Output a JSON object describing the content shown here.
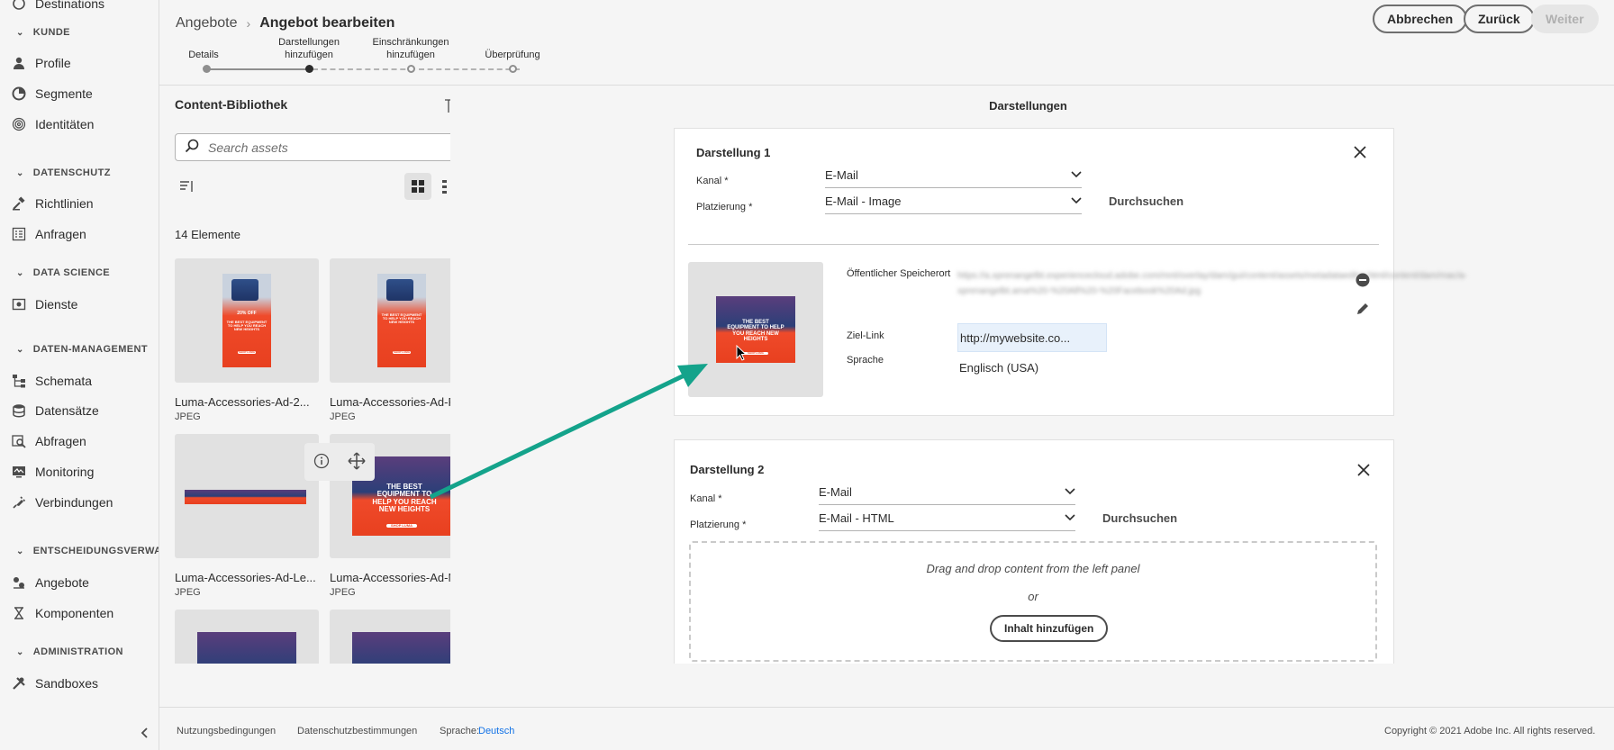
{
  "sidebar": {
    "top_item": "Destinations",
    "sections": [
      {
        "label": "KUNDE"
      },
      {
        "label": "DATENSCHUTZ"
      },
      {
        "label": "DATA SCIENCE"
      },
      {
        "label": "DATEN-MANAGEMENT"
      },
      {
        "label": "ENTSCHEIDUNGSVERWALT"
      },
      {
        "label": "ADMINISTRATION"
      }
    ],
    "items": {
      "profile": "Profile",
      "segmente": "Segmente",
      "identitaeten": "Identitäten",
      "richtlinien": "Richtlinien",
      "anfragen": "Anfragen",
      "dienste": "Dienste",
      "schemata": "Schemata",
      "datensaetze": "Datensätze",
      "abfragen": "Abfragen",
      "monitoring": "Monitoring",
      "verbindungen": "Verbindungen",
      "angebote": "Angebote",
      "komponenten": "Komponenten",
      "sandboxes": "Sandboxes"
    }
  },
  "header": {
    "breadcrumb_parent": "Angebote",
    "breadcrumb_current": "Angebot bearbeiten",
    "buttons": {
      "cancel": "Abbrechen",
      "back": "Zurück",
      "next": "Weiter"
    },
    "steps": [
      {
        "label": "Details",
        "state": "done"
      },
      {
        "label": "Darstellungen hinzufügen",
        "state": "active"
      },
      {
        "label": "Einschränkungen hinzufügen",
        "state": "open"
      },
      {
        "label": "Überprüfung",
        "state": "open"
      }
    ]
  },
  "library": {
    "title": "Content-Bibliothek",
    "search_placeholder": "Search assets",
    "count": "14 Elemente",
    "assets": [
      {
        "name": "Luma-Accessories-Ad-2...",
        "type": "JPEG"
      },
      {
        "name": "Luma-Accessories-Ad-Fi...",
        "type": "JPEG"
      },
      {
        "name": "Luma-Accessories-Ad-Le...",
        "type": "JPEG"
      },
      {
        "name": "Luma-Accessories-Ad-M...",
        "type": "JPEG"
      }
    ],
    "ad_texts": {
      "sale": "20% OFF",
      "headline": "THE BEST EQUIPMENT TO HELP YOU REACH NEW HEIGHTS",
      "cta": "SHOP LUMA"
    }
  },
  "main": {
    "title": "Darstellungen",
    "rep1": {
      "title": "Darstellung 1",
      "kanal_label": "Kanal *",
      "kanal_value": "E-Mail",
      "platzierung_label": "Platzierung *",
      "platzierung_value": "E-Mail - Image",
      "browse": "Durchsuchen",
      "public_location_label": "Öffentlicher Speicherort",
      "target_link_label": "Ziel-Link",
      "target_link_value": "http://mywebsite.co...",
      "language_label": "Sprache",
      "language_value": "Englisch (USA)"
    },
    "rep2": {
      "title": "Darstellung 2",
      "kanal_label": "Kanal *",
      "kanal_value": "E-Mail",
      "platzierung_label": "Platzierung *",
      "platzierung_value": "E-Mail - HTML",
      "browse": "Durchsuchen",
      "drop_text": "Drag and drop content from the left panel",
      "or_text": "or",
      "add_button": "Inhalt hinzufügen"
    }
  },
  "footer": {
    "terms": "Nutzungsbedingungen",
    "privacy": "Datenschutzbestimmungen",
    "language_label": "Sprache:",
    "language_value": "Deutsch",
    "copyright": "Copyright © 2021 Adobe Inc. All rights reserved."
  },
  "colors": {
    "accent": "#1473e6",
    "arrow": "#14a38b",
    "ad_orange": "#ef4a2a",
    "ad_navy": "#2c3f78"
  }
}
